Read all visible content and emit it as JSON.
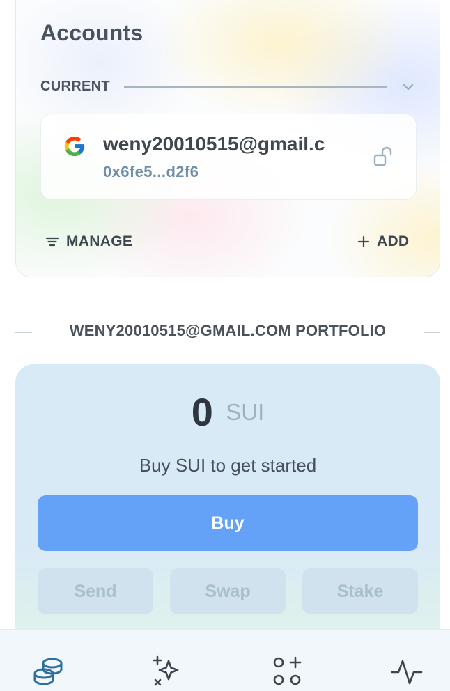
{
  "accounts": {
    "title": "Accounts",
    "current_label": "CURRENT",
    "selected_account": {
      "email": "weny20010515@gmail.c",
      "address": "0x6fe5...d2f6",
      "provider_icon": "google-icon",
      "lock_icon": "unlock-icon"
    },
    "manage_label": "MANAGE",
    "add_label": "ADD"
  },
  "portfolio": {
    "heading": "WENY20010515@GMAIL.COM PORTFOLIO",
    "balance_amount": "0",
    "balance_unit": "SUI",
    "hint": "Buy SUI to get started",
    "buy_label": "Buy",
    "actions": {
      "send": "Send",
      "swap": "Swap",
      "stake": "Stake"
    }
  },
  "nav": {
    "items": [
      "coins-icon",
      "sparkle-icon",
      "apps-icon",
      "activity-icon"
    ],
    "active": "coins-icon"
  },
  "colors": {
    "accent": "#63a2f7",
    "nav_active": "#2e6f9e",
    "card_bg": "#d9eaf7"
  }
}
